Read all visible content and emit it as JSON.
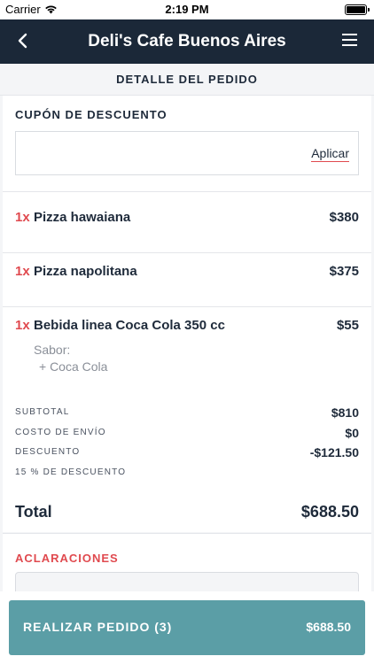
{
  "status_bar": {
    "carrier": "Carrier",
    "time": "2:19 PM",
    "wifi_icon": "wifi-icon",
    "battery_icon": "battery-icon"
  },
  "navbar": {
    "title": "Deli's Cafe Buenos Aires",
    "back_icon": "chevron-left-icon",
    "menu_icon": "hamburger-menu-icon",
    "background": "#1b2838"
  },
  "section": {
    "title": "DETALLE DEL PEDIDO"
  },
  "coupon": {
    "label": "CUPÓN DE DESCUENTO",
    "input_value": "",
    "apply_label": "Aplicar"
  },
  "items": [
    {
      "qty": "1x",
      "name": "Pizza hawaiana",
      "price": "$380"
    },
    {
      "qty": "1x",
      "name": "Pizza napolitana",
      "price": "$375"
    },
    {
      "qty": "1x",
      "name": "Bebida linea Coca Cola 350 cc",
      "price": "$55",
      "option_label": "Sabor:",
      "option_value": "+ Coca Cola"
    }
  ],
  "summary": {
    "subtotal_label": "SUBTOTAL",
    "subtotal_value": "$810",
    "shipping_label": "COSTO DE ENVÍO",
    "shipping_value": "$0",
    "discount_label": "DESCUENTO",
    "discount_value": "-$121.50",
    "discount_note": "15 % DE DESCUENTO"
  },
  "total": {
    "label": "Total",
    "value": "$688.50"
  },
  "notes": {
    "label": "ACLARACIONES",
    "value": ""
  },
  "footer": {
    "order_label": "REALIZAR PEDIDO (3)",
    "order_total": "$688.50",
    "accent": "#5b9ea6"
  },
  "colors": {
    "accent_red": "#e04a4f",
    "text_dark": "#1e2a3a",
    "muted": "#8a8f98"
  }
}
